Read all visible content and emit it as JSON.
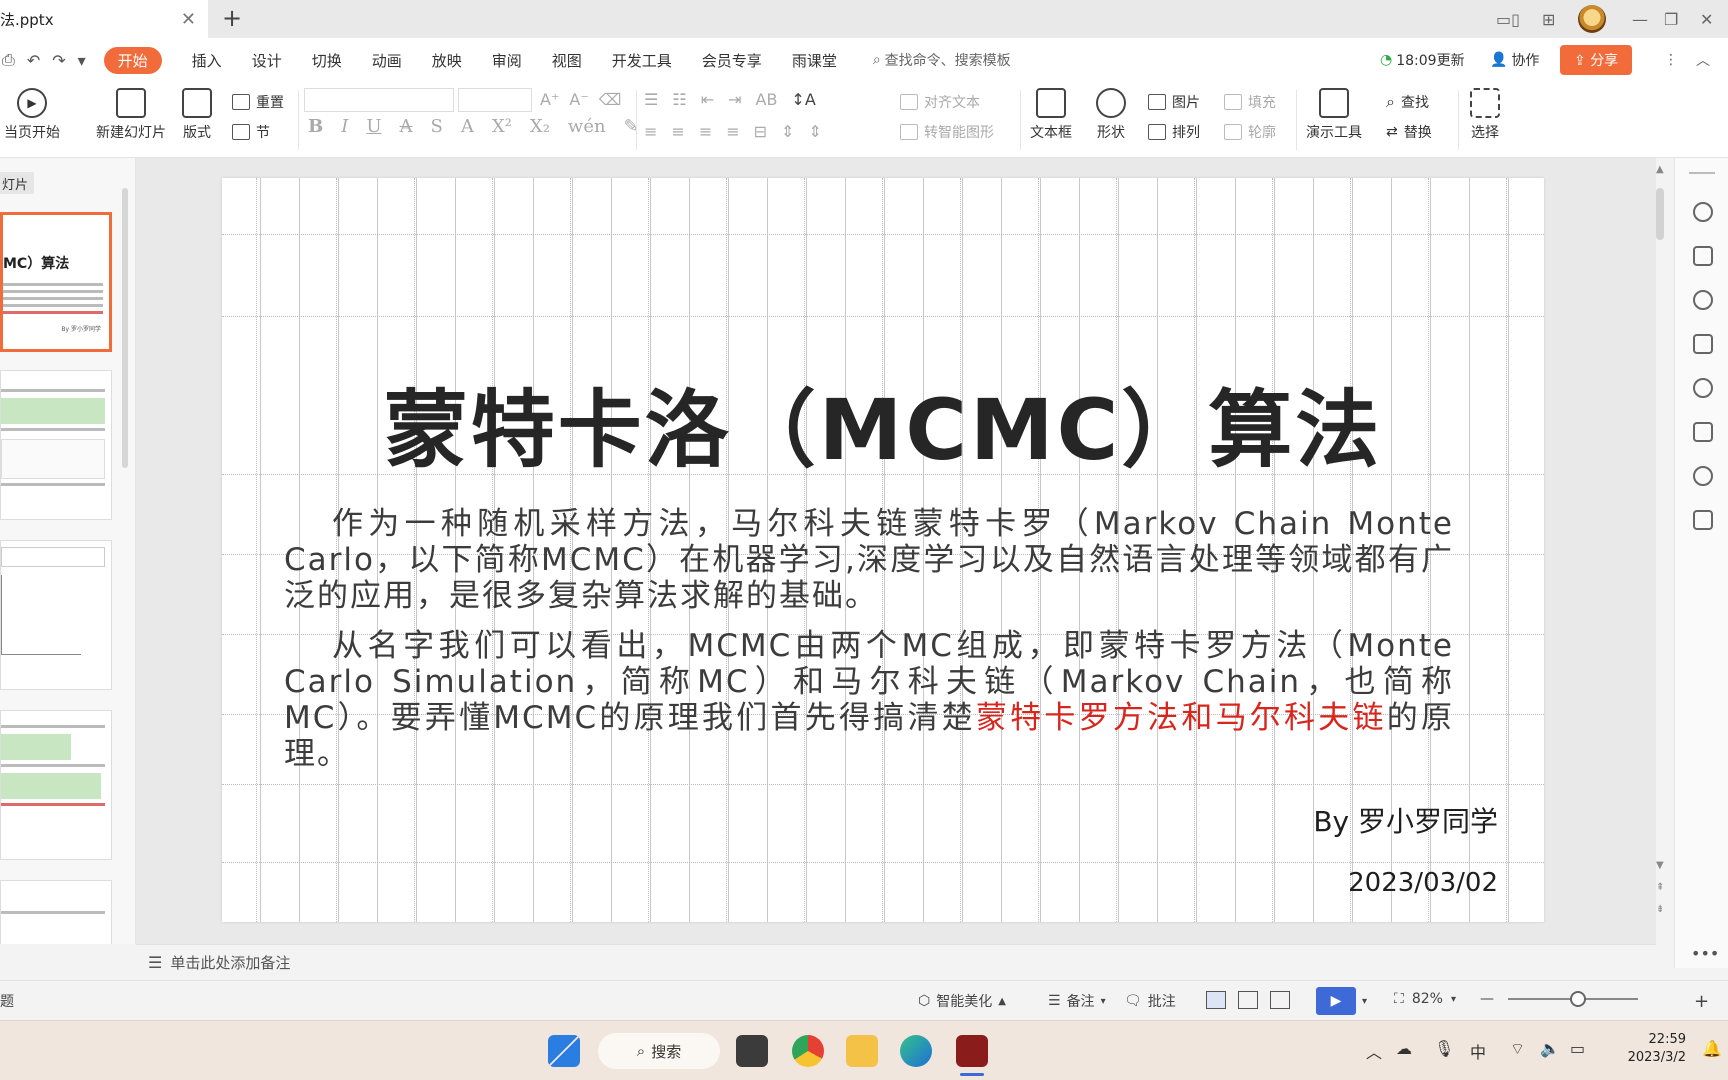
{
  "titlebar": {
    "file_tab": "法.pptx",
    "close_glyph": "✕",
    "add_glyph": "+"
  },
  "menu": {
    "items": [
      "开始",
      "插入",
      "设计",
      "切换",
      "动画",
      "放映",
      "审阅",
      "视图",
      "开发工具",
      "会员专享",
      "雨课堂"
    ],
    "search_placeholder": "查找命令、搜索模板",
    "update_text": "18:09更新",
    "collab": "协作",
    "share": "分享"
  },
  "ribbon": {
    "play_from_current": "当页开始",
    "new_slide": "新建幻灯片",
    "layout": "版式",
    "reset": "重置",
    "section": "节",
    "align_text": "对齐文本",
    "smart_shape": "转智能图形",
    "textbox": "文本框",
    "shape": "形状",
    "picture": "图片",
    "arrange": "排列",
    "fill": "填充",
    "outline": "轮廓",
    "present_tools": "演示工具",
    "find": "查找",
    "replace": "替换",
    "select": "选择"
  },
  "thumbs": {
    "panel_label": "灯片",
    "slide1_title": "MC）算法",
    "slide1_by": "By 罗小罗同学"
  },
  "slide": {
    "title": "蒙特卡洛（MCMC）算法",
    "para1": "作为一种随机采样方法，马尔科夫链蒙特卡罗（Markov Chain Monte Carlo，以下简称MCMC）在机器学习,深度学习以及自然语言处理等领域都有广泛的应用，是很多复杂算法求解的基础。",
    "para2_main": "从名字我们可以看出，MCMC由两个MC组成，即蒙特卡罗方法（Monte Carlo Simulation，简称MC）和马尔科夫链（Markov Chain，也简称MC）。要弄懂MCMC的原理我们首先得搞清楚",
    "para2_red": "蒙特卡罗方法和马尔科夫链",
    "para2_tail": "的原理。",
    "byline": "By 罗小罗同学",
    "date": "2023/03/02"
  },
  "notes": {
    "placeholder": "单击此处添加备注"
  },
  "status": {
    "left": "题",
    "beautify": "智能美化",
    "notes": "备注",
    "comment": "批注",
    "zoom": "82%"
  },
  "taskbar": {
    "search": "搜索",
    "ime": "中",
    "time": "22:59",
    "date": "2023/3/2"
  },
  "colors": {
    "accent": "#f26b3a",
    "red_text": "#d9261c",
    "play_blue": "#3d6ad6"
  }
}
